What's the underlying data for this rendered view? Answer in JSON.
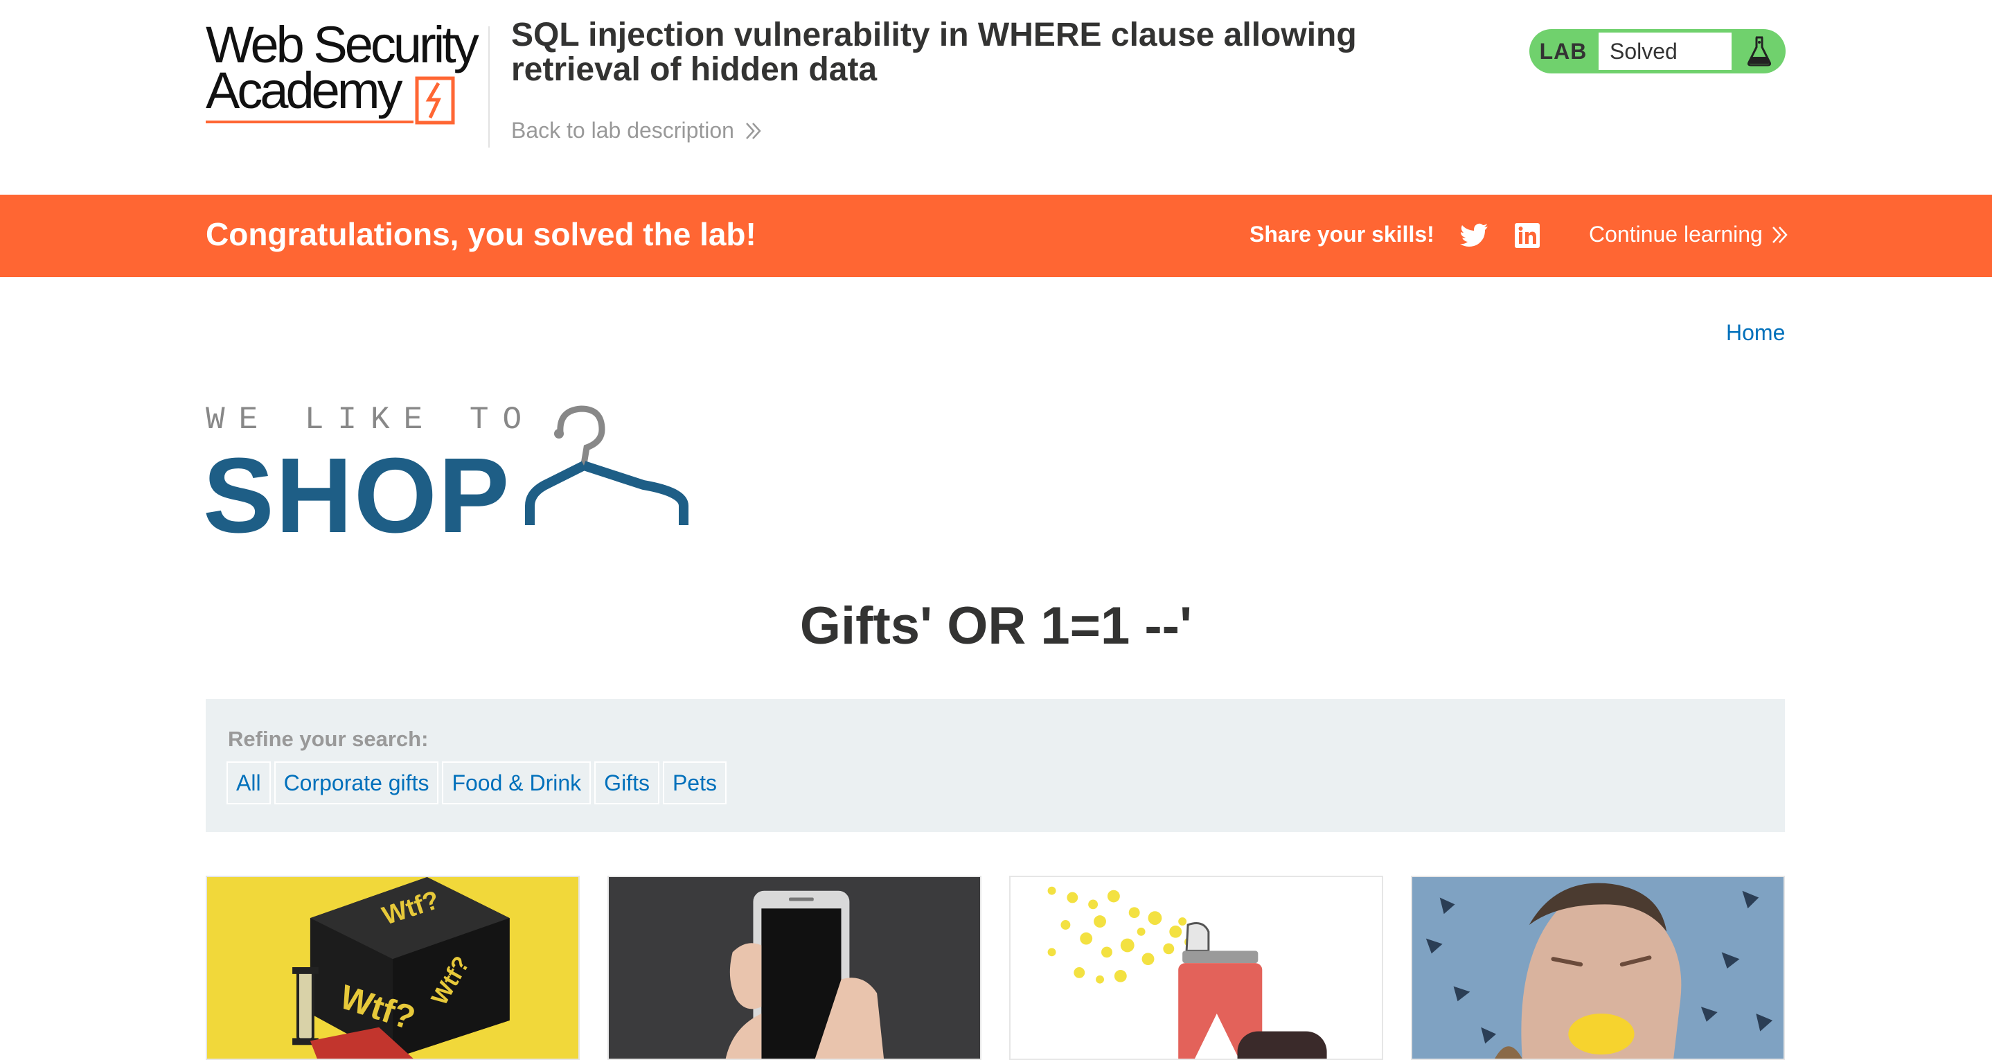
{
  "lab": {
    "logo_line1": "Web Security",
    "logo_line2": "Academy",
    "title": "SQL injection vulnerability in WHERE clause allowing retrieval of hidden data",
    "back_link": "Back to lab description",
    "status_label": "LAB",
    "status_value": "Solved"
  },
  "banner": {
    "message": "Congratulations, you solved the lab!",
    "share_label": "Share your skills!",
    "continue_label": "Continue learning"
  },
  "nav": {
    "home": "Home"
  },
  "shop": {
    "tagline": "WE LIKE TO",
    "brand": "SHOP"
  },
  "category_title": "Gifts' OR 1=1 --'",
  "filters": {
    "label": "Refine your search:",
    "items": [
      "All",
      "Corporate gifts",
      "Food & Drink",
      "Gifts",
      "Pets"
    ]
  },
  "products": [
    {
      "icon": "board-game-image"
    },
    {
      "icon": "phone-image"
    },
    {
      "icon": "spray-can-image"
    },
    {
      "icon": "lemon-face-image"
    }
  ],
  "colors": {
    "brand_orange": "#ff6633",
    "lab_green": "#70d16d",
    "shop_blue": "#1e5e86",
    "link_blue": "#0070bb",
    "filter_bg": "#ebf0f2"
  }
}
